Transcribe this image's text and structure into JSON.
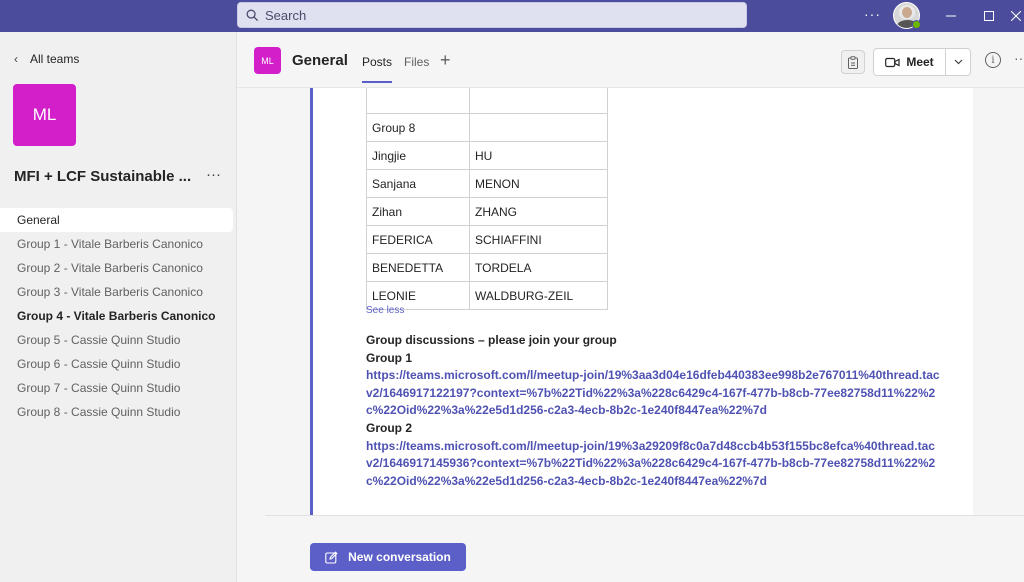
{
  "titlebar": {
    "search_placeholder": "Search",
    "more_label": "···"
  },
  "sidebar": {
    "back_label": "All teams",
    "team_initials": "ML",
    "team_name": "MFI + LCF Sustainable ...",
    "team_more": "···",
    "channels": [
      {
        "label": "General"
      },
      {
        "label": "Group 1 - Vitale Barberis Canonico"
      },
      {
        "label": "Group 2 - Vitale Barberis Canonico"
      },
      {
        "label": "Group 3 - Vitale Barberis Canonico"
      },
      {
        "label": "Group 4 - Vitale Barberis Canonico"
      },
      {
        "label": "Group 5 - Cassie Quinn Studio"
      },
      {
        "label": "Group 6 - Cassie Quinn Studio"
      },
      {
        "label": "Group 7 - Cassie Quinn Studio"
      },
      {
        "label": "Group 8 - Cassie Quinn Studio"
      }
    ]
  },
  "header": {
    "tile": "ML",
    "title": "General",
    "tabs": [
      {
        "label": "Posts"
      },
      {
        "label": "Files"
      }
    ],
    "add_tab": "+",
    "meet_label": "Meet",
    "info_label": "i",
    "more_label": "··"
  },
  "post": {
    "table_rows": [
      [
        "",
        ""
      ],
      [
        "Group 8",
        ""
      ],
      [
        "Jingjie",
        "HU"
      ],
      [
        "Sanjana",
        "MENON"
      ],
      [
        "Zihan",
        "ZHANG"
      ],
      [
        "FEDERICA",
        "SCHIAFFINI"
      ],
      [
        "BENEDETTA",
        "TORDELA"
      ],
      [
        "LEONIE",
        "WALDBURG-ZEIL"
      ]
    ],
    "see_less": "See less",
    "discussion_heading": "Group discussions – please join your group",
    "groups": [
      {
        "label": "Group 1",
        "link": "https://teams.microsoft.com/l/meetup-join/19%3aa3d04e16dfeb440383ee998b2e767011%40thread.tacv2/1646917122197?context=%7b%22Tid%22%3a%228c6429c4-167f-477b-b8cb-77ee82758d11%22%2c%22Oid%22%3a%22e5d1d256-c2a3-4ecb-8b2c-1e240f8447ea%22%7d"
      },
      {
        "label": "Group 2",
        "link": "https://teams.microsoft.com/l/meetup-join/19%3a29209f8c0a7d48ccb4b53f155bc8efca%40thread.tacv2/1646917145936?context=%7b%22Tid%22%3a%228c6429c4-167f-477b-b8cb-77ee82758d11%22%2c%22Oid%22%3a%22e5d1d256-c2a3-4ecb-8b2c-1e240f8447ea%22%7d"
      }
    ]
  },
  "composer": {
    "new_conversation_label": "New conversation"
  }
}
